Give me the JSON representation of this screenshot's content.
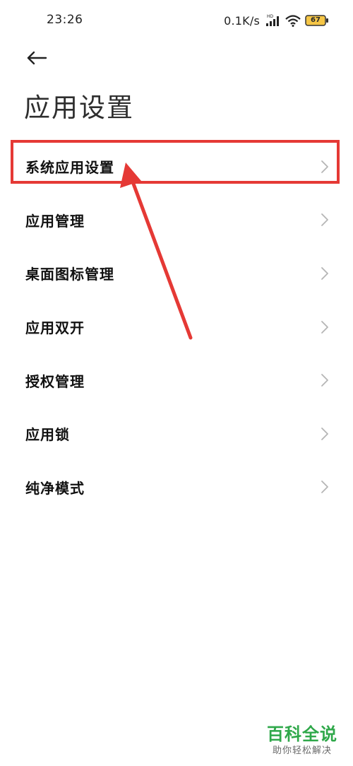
{
  "status_bar": {
    "time": "23:26",
    "net_speed": "0.1K/s",
    "network_badge": "HD",
    "battery_level": "67",
    "icons": [
      "signal-icon",
      "wifi-icon",
      "battery-icon"
    ]
  },
  "header": {
    "back_icon": "arrow-left-icon",
    "title": "应用设置"
  },
  "settings": {
    "items": [
      {
        "label": "系统应用设置",
        "icon": "chevron-right-icon",
        "highlighted": true
      },
      {
        "label": "应用管理",
        "icon": "chevron-right-icon"
      },
      {
        "label": "桌面图标管理",
        "icon": "chevron-right-icon"
      },
      {
        "label": "应用双开",
        "icon": "chevron-right-icon"
      },
      {
        "label": "授权管理",
        "icon": "chevron-right-icon"
      },
      {
        "label": "应用锁",
        "icon": "chevron-right-icon"
      },
      {
        "label": "纯净模式",
        "icon": "chevron-right-icon"
      }
    ]
  },
  "annotation": {
    "color": "#e53935"
  },
  "watermark": {
    "title": "百科全说",
    "subtitle": "助你轻松解决",
    "color": "#2fa84a"
  }
}
